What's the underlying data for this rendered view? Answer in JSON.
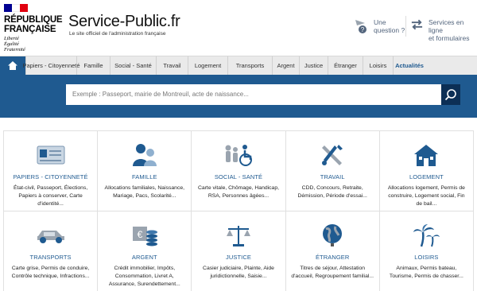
{
  "header": {
    "republic_line1": "RÉPUBLIQUE",
    "republic_line2": "FRANÇAISE",
    "motto": [
      "Liberté",
      "Égalité",
      "Fraternité"
    ],
    "site_name": "Service-Public.fr",
    "tagline": "Le site officiel de l'administration française",
    "question_link": [
      "Une",
      "question ?"
    ],
    "services_link": [
      "Services en ligne",
      "et formulaires"
    ]
  },
  "nav": {
    "items": [
      "Papiers - Citoyenneté",
      "Famille",
      "Social - Santé",
      "Travail",
      "Logement",
      "Transports",
      "Argent",
      "Justice",
      "Étranger",
      "Loisirs",
      "Actualités"
    ],
    "active": "Actualités"
  },
  "search": {
    "placeholder": "Exemple : Passeport, mairie de Montreuil, acte de naissance..."
  },
  "categories": [
    {
      "title": "PAPIERS - CITOYENNETÉ",
      "desc": "État-civil, Passeport, Élections, Papiers à conserver, Carte d'identité...",
      "icon": "id-card-icon"
    },
    {
      "title": "FAMILLE",
      "desc": "Allocations familiales, Naissance, Mariage, Pacs, Scolarité...",
      "icon": "family-icon"
    },
    {
      "title": "SOCIAL - SANTÉ",
      "desc": "Carte vitale, Chômage, Handicap, RSA, Personnes âgées...",
      "icon": "social-health-icon"
    },
    {
      "title": "TRAVAIL",
      "desc": "CDD, Concours, Retraite, Démission, Période d'essai...",
      "icon": "tools-icon"
    },
    {
      "title": "LOGEMENT",
      "desc": "Allocations logement, Permis de construire, Logement social, Fin de bail...",
      "icon": "house-icon"
    },
    {
      "title": "TRANSPORTS",
      "desc": "Carte grise, Permis de conduire, Contrôle technique, Infractions...",
      "icon": "car-icon"
    },
    {
      "title": "ARGENT",
      "desc": "Crédit immobilier, Impôts, Consommation, Livret A, Assurance, Surendettement...",
      "icon": "money-icon"
    },
    {
      "title": "JUSTICE",
      "desc": "Casier judiciaire, Plainte, Aide juridictionnelle, Saisie...",
      "icon": "scales-icon"
    },
    {
      "title": "ÉTRANGER",
      "desc": "Titres de séjour, Attestation d'accueil, Regroupement familial...",
      "icon": "globe-icon"
    },
    {
      "title": "LOISIRS",
      "desc": "Animaux, Permis bateau, Tourisme, Permis de chasser...",
      "icon": "palm-tree-icon"
    }
  ],
  "colors": {
    "primary": "#1f5a90",
    "search_button": "#0c2f55",
    "nav_bg": "#eaeaea"
  }
}
